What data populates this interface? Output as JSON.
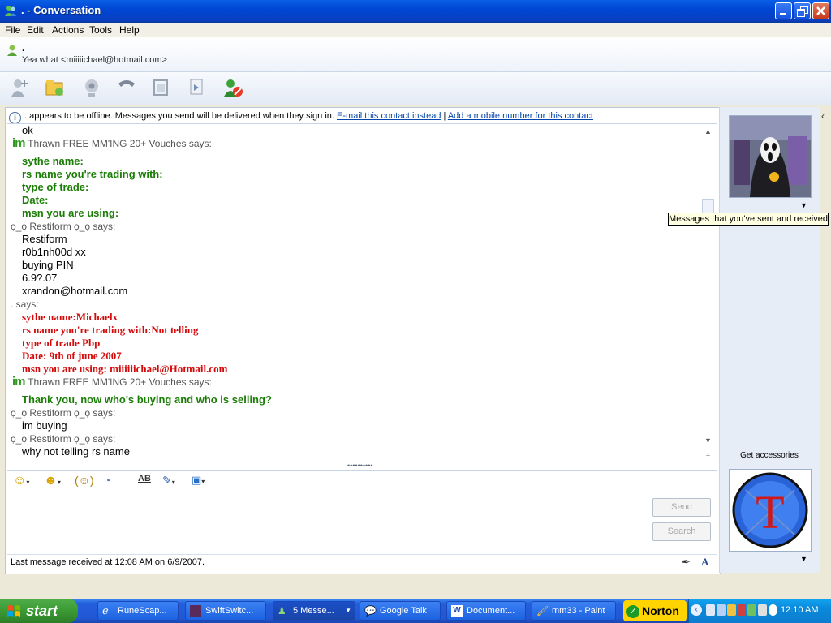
{
  "window": {
    "title": ". - Conversation",
    "controls": [
      "minimize",
      "maximize",
      "close"
    ]
  },
  "menu": [
    "File",
    "Edit",
    "Actions",
    "Tools",
    "Help"
  ],
  "contact": {
    "name": ".",
    "status": "Yea what <miiiiichael@hotmail.com>"
  },
  "toolbar_icons": [
    "invite-icon",
    "send-files-icon",
    "webcam-icon",
    "call-icon",
    "video-icon",
    "share-icon",
    "block-icon"
  ],
  "infobar": {
    "text": ". appears to be offline. Messages you send will be delivered when they sign in.",
    "link_email": "E-mail this contact instead",
    "separator": "|",
    "link_mobile": "Add a mobile number for this contact"
  },
  "messages": [
    {
      "kind": "text",
      "style": "plain",
      "text": "ok"
    },
    {
      "kind": "header",
      "im": "im",
      "text": "Thrawn FREE MM'ING 20+ Vouches says:"
    },
    {
      "kind": "text",
      "style": "green",
      "text": "sythe name:"
    },
    {
      "kind": "text",
      "style": "green",
      "text": "rs name you're trading with:"
    },
    {
      "kind": "text",
      "style": "green",
      "text": "type of trade:"
    },
    {
      "kind": "text",
      "style": "green",
      "text": "Date:"
    },
    {
      "kind": "text",
      "style": "green",
      "text": "msn you are using:"
    },
    {
      "kind": "header",
      "im": "",
      "text": "ọ_ọ Restiform ọ_ọ says:"
    },
    {
      "kind": "text",
      "style": "plain",
      "text": "Restiform"
    },
    {
      "kind": "text",
      "style": "plain",
      "text": "r0b1nh00d xx"
    },
    {
      "kind": "text",
      "style": "plain",
      "text": "buying PIN"
    },
    {
      "kind": "text",
      "style": "plain",
      "text": "6.9?.07"
    },
    {
      "kind": "text",
      "style": "plain",
      "text": "xrandon@hotmail.com"
    },
    {
      "kind": "header",
      "im": "",
      "text": ". says:"
    },
    {
      "kind": "text",
      "style": "red",
      "text": "sythe name:Michaelx"
    },
    {
      "kind": "text",
      "style": "red",
      "text": "rs name you're trading with:Not telling"
    },
    {
      "kind": "text",
      "style": "red",
      "text": "type of trade Pbp"
    },
    {
      "kind": "text",
      "style": "red",
      "text": "Date: 9th of june 2007"
    },
    {
      "kind": "text",
      "style": "red",
      "text": "msn you are using: miiiiiichael@Hotmail.com"
    },
    {
      "kind": "header",
      "im": "im",
      "text": "Thrawn FREE MM'ING 20+ Vouches says:"
    },
    {
      "kind": "text",
      "style": "green",
      "text": "Thank you, now who's buying and who is selling?"
    },
    {
      "kind": "header",
      "im": "",
      "text": "ọ_ọ Restiform ọ_ọ says:"
    },
    {
      "kind": "text",
      "style": "plain",
      "text": "im buying"
    },
    {
      "kind": "header",
      "im": "",
      "text": "ọ_ọ Restiform ọ_ọ says:"
    },
    {
      "kind": "text",
      "style": "plain",
      "text": "why not telling rs name"
    }
  ],
  "compose": {
    "send_label": "Send",
    "search_label": "Search",
    "status_text": "Last message received at 12:08 AM on 6/9/2007."
  },
  "tooltip": "Messages that you've sent and received",
  "sidebar": {
    "get_accessories": "Get accessories",
    "display_letter": "T"
  },
  "taskbar": {
    "start_label": "start",
    "tasks": [
      {
        "label": "RuneScap...",
        "active": false
      },
      {
        "label": "SwiftSwitc...",
        "active": false
      },
      {
        "label": "5 Messe...",
        "active": true
      },
      {
        "label": "Google Talk",
        "active": false
      },
      {
        "label": "Document...",
        "active": false
      },
      {
        "label": "mm33 - Paint",
        "active": false
      }
    ],
    "norton_label": "Norton",
    "clock": "12:10 AM"
  },
  "colors": {
    "green_text": "#1a7d05",
    "red_text": "#d30b0b",
    "xp_blue": "#0a5fe6",
    "start_green": "#3c9a35"
  }
}
